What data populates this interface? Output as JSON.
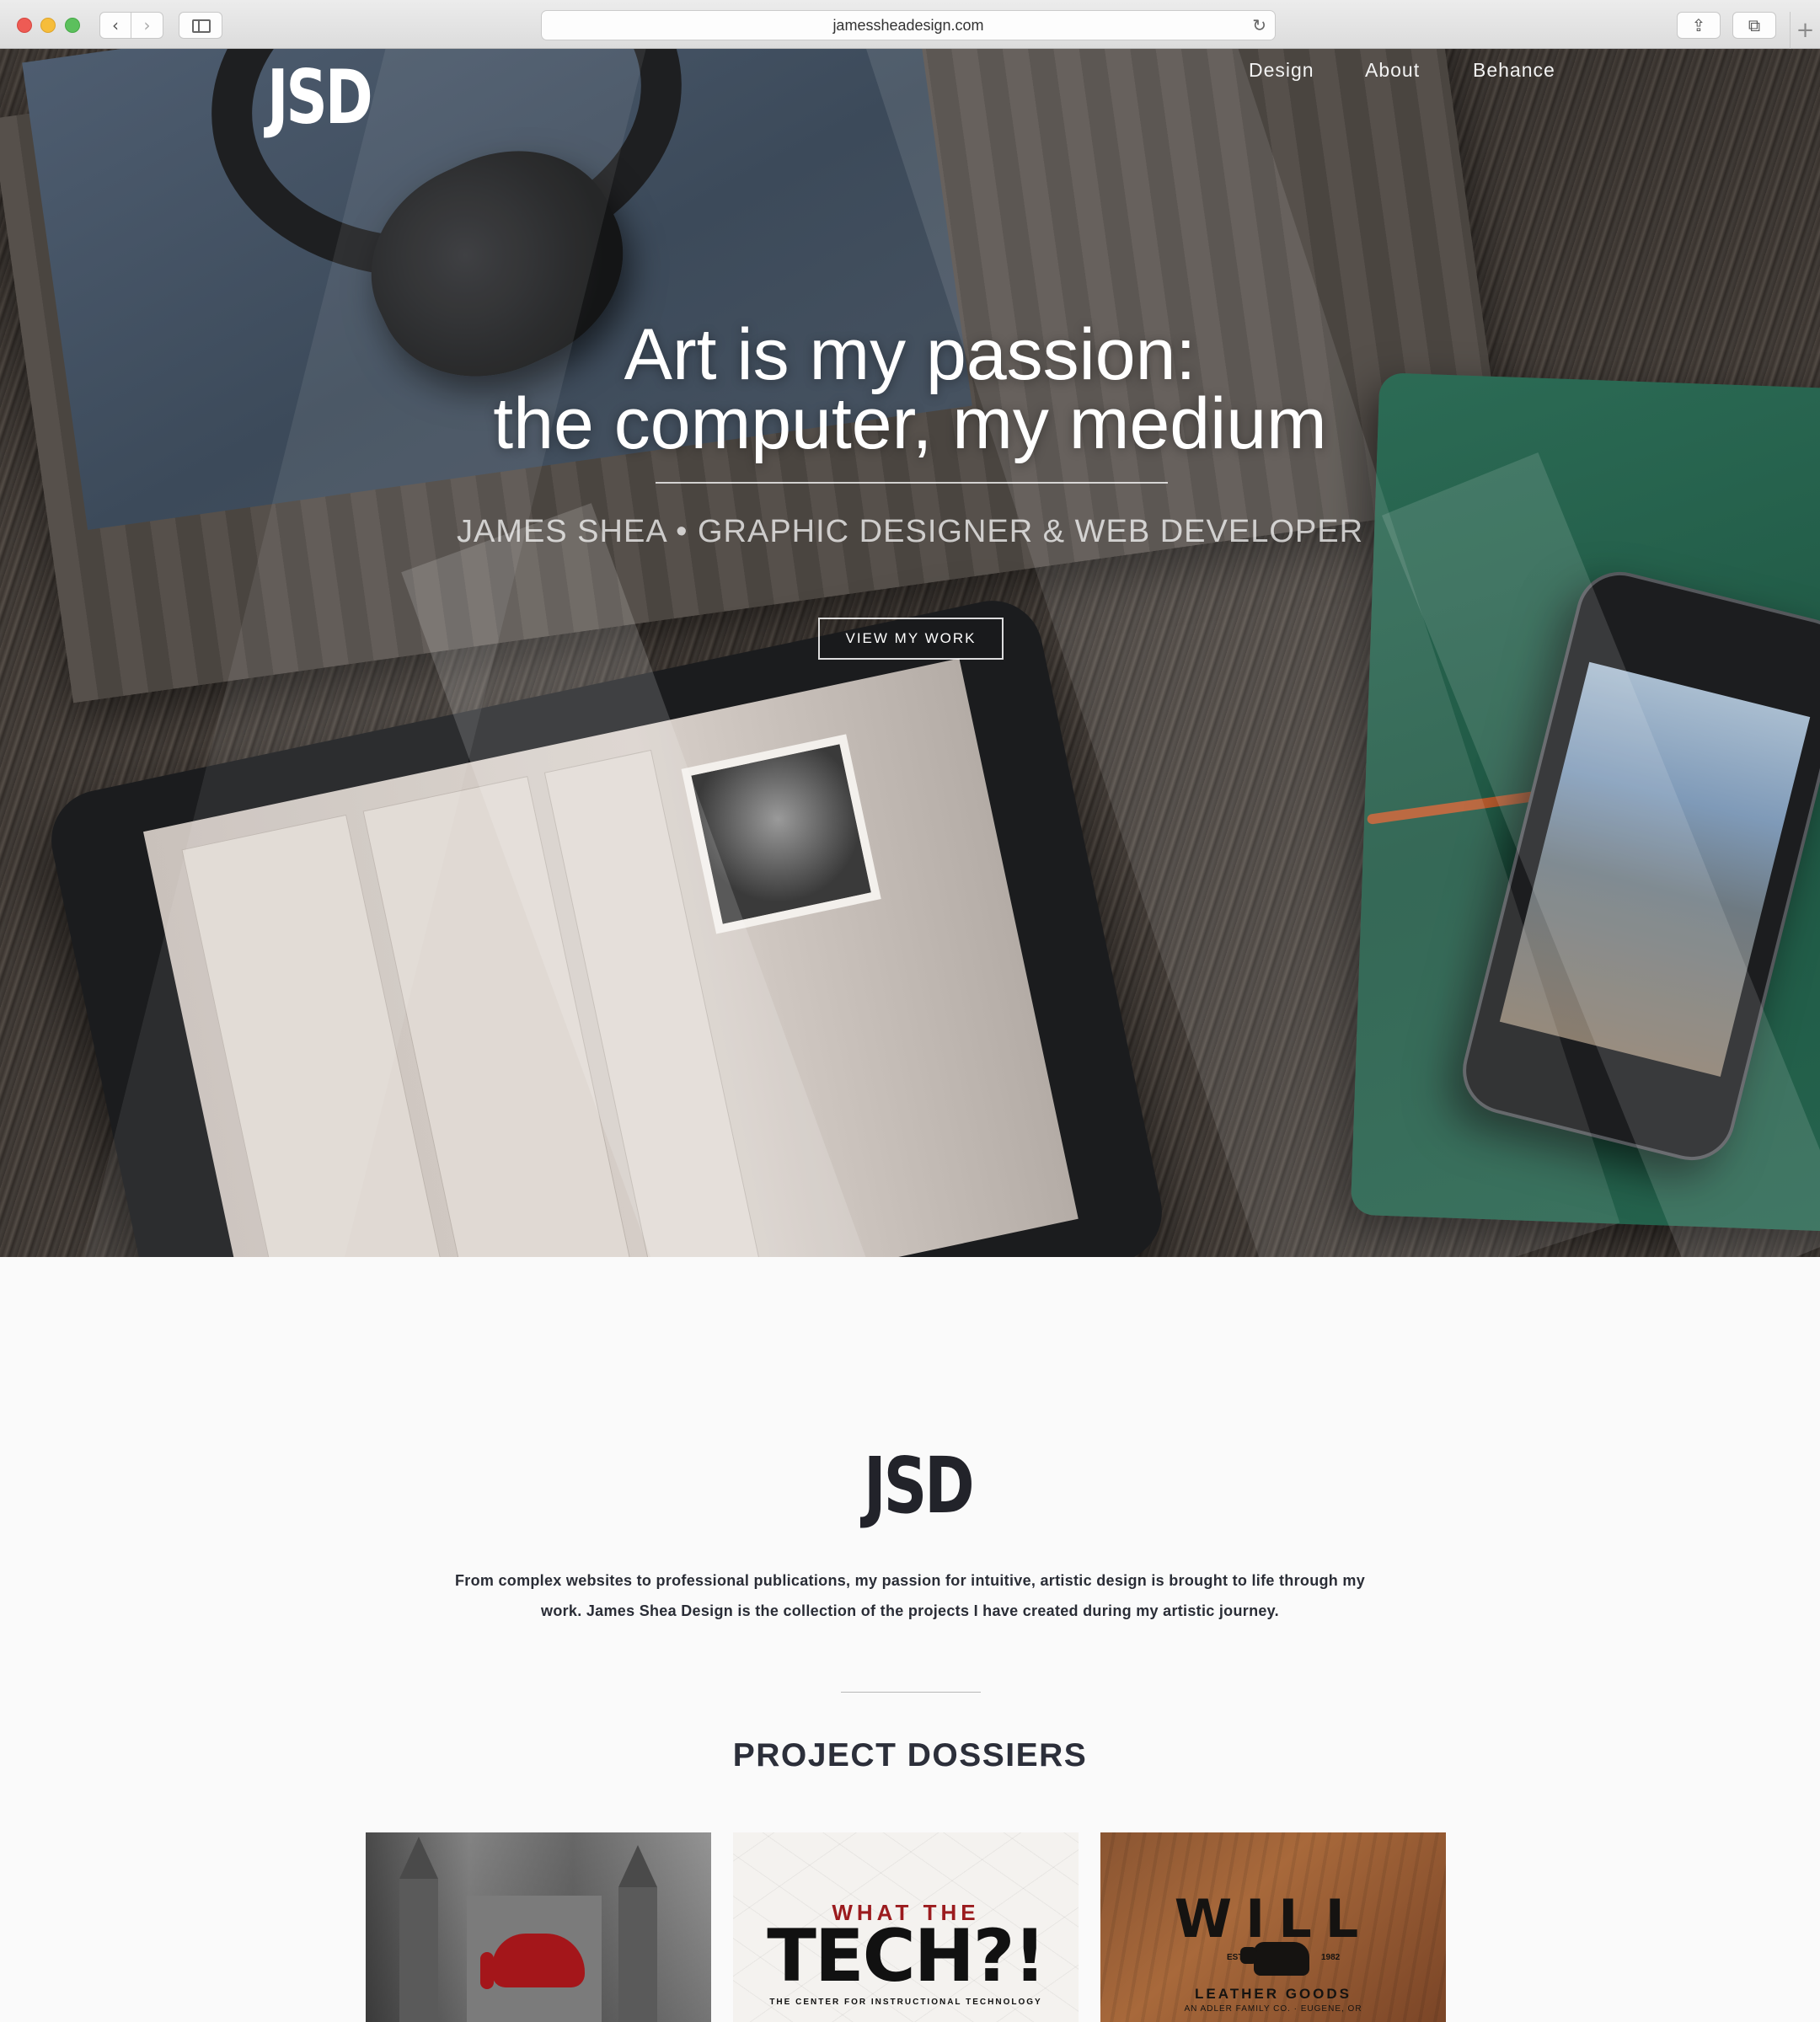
{
  "browser": {
    "url": "jamessheadesign.com",
    "back_glyph": "‹",
    "forward_glyph": "›",
    "reload_glyph": "↻",
    "share_glyph": "⇪",
    "tabs_glyph": "⧉",
    "new_tab_glyph": "+"
  },
  "site": {
    "logo": "JSD",
    "nav": [
      "Design",
      "About",
      "Behance"
    ]
  },
  "hero": {
    "headline_line1": "Art is my passion:",
    "headline_line2": "the computer, my medium",
    "subtitle": "JAMES SHEA • GRAPHIC DESIGNER & WEB DEVELOPER",
    "cta": "VIEW MY WORK"
  },
  "about": {
    "logo": "JSD",
    "text": "From complex websites to professional publications, my passion for intuitive, artistic design is brought to life through my work. James Shea Design is the collection of the projects I have created during my artistic journey."
  },
  "projects": {
    "title": "PROJECT DOSSIERS",
    "tiles": [
      {
        "name": "university-building"
      },
      {
        "top": "WHAT THE",
        "main": "TECH?!",
        "sub": "THE CENTER FOR INSTRUCTIONAL TECHNOLOGY"
      },
      {
        "title": "WILL",
        "est_left": "EST",
        "est_right": "1982",
        "sub": "LEATHER GOODS",
        "sub2": "AN ADLER FAMILY CO. · EUGENE, OR"
      }
    ]
  },
  "colors": {
    "accent_red": "#a4161a",
    "text_dark": "#2a2d36",
    "page_bg": "#fafafa"
  }
}
